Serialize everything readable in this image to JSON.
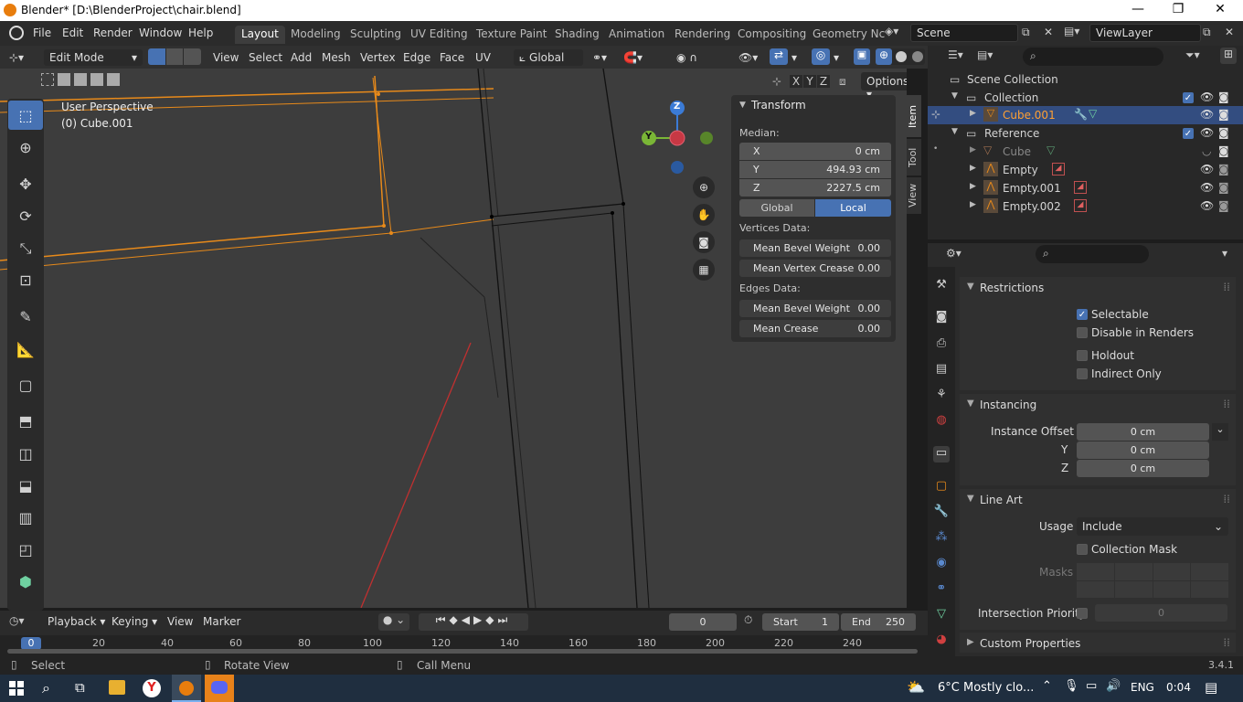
{
  "window": {
    "title": "Blender* [D:\\BlenderProject\\chair.blend]",
    "controls": [
      "—",
      "❐",
      "✕"
    ]
  },
  "menus": [
    "File",
    "Edit",
    "Render",
    "Window",
    "Help"
  ],
  "workspaces": [
    "Layout",
    "Modeling",
    "Sculpting",
    "UV Editing",
    "Texture Paint",
    "Shading",
    "Animation",
    "Rendering",
    "Compositing",
    "Geometry Nc"
  ],
  "active_workspace": "Layout",
  "scene": "Scene",
  "view_layer": "ViewLayer",
  "viewport_header": {
    "mode": "Edit Mode",
    "menus": [
      "View",
      "Select",
      "Add",
      "Mesh",
      "Vertex",
      "Edge",
      "Face",
      "UV"
    ],
    "orientation": "Global",
    "options": "Options",
    "axes": [
      "X",
      "Y",
      "Z"
    ]
  },
  "viewport": {
    "view_name": "User Perspective",
    "object": "(0) Cube.001"
  },
  "gizmo": {
    "z": "Z",
    "y": "Y"
  },
  "npanel": {
    "tabs": [
      "Item",
      "Tool",
      "View"
    ],
    "title": "Transform",
    "median_label": "Median:",
    "x_label": "X",
    "x": "0 cm",
    "y_label": "Y",
    "y": "494.93 cm",
    "z_label": "Z",
    "z": "2227.5 cm",
    "global": "Global",
    "local": "Local",
    "vertices_data": "Vertices Data:",
    "mean_bevel_weight": "Mean Bevel Weight",
    "mbw_val": "0.00",
    "mean_vertex_crease": "Mean Vertex Crease",
    "mvc_val": "0.00",
    "edges_data": "Edges Data:",
    "edge_bevel_weight": "Mean Bevel Weight",
    "ebw_val": "0.00",
    "mean_crease": "Mean Crease",
    "mc_val": "0.00"
  },
  "outliner": {
    "scene_collection": "Scene Collection",
    "collection": "Collection",
    "cube001": "Cube.001",
    "reference": "Reference",
    "cube": "Cube",
    "empty": "Empty",
    "empty001": "Empty.001",
    "empty002": "Empty.002"
  },
  "props": {
    "restrictions": "Restrictions",
    "selectable": "Selectable",
    "disable_in_renders": "Disable in Renders",
    "holdout": "Holdout",
    "indirect_only": "Indirect Only",
    "instancing": "Instancing",
    "instance_offset_x": "Instance Offset X",
    "y_label": "Y",
    "z_label": "Z",
    "offset_x": "0 cm",
    "offset_y": "0 cm",
    "offset_z": "0 cm",
    "line_art": "Line Art",
    "usage_label": "Usage",
    "usage": "Include",
    "collection_mask": "Collection Mask",
    "masks": "Masks",
    "intersection_priority": "Intersection Priority",
    "priority_val": "0",
    "custom_properties": "Custom Properties"
  },
  "timeline": {
    "playback": "Playback",
    "keying": "Keying",
    "view": "View",
    "marker": "Marker",
    "current_frame": "0",
    "start_label": "Start",
    "start": "1",
    "end_label": "End",
    "end": "250",
    "ruler": [
      "0",
      "20",
      "40",
      "60",
      "80",
      "100",
      "120",
      "140",
      "160",
      "180",
      "200",
      "220",
      "240"
    ]
  },
  "status": {
    "select": "Select",
    "rotate_view": "Rotate View",
    "call_menu": "Call Menu",
    "version": "3.4.1"
  },
  "taskbar": {
    "weather": "6°C  Mostly clo...",
    "lang": "ENG",
    "time": "0:04"
  }
}
